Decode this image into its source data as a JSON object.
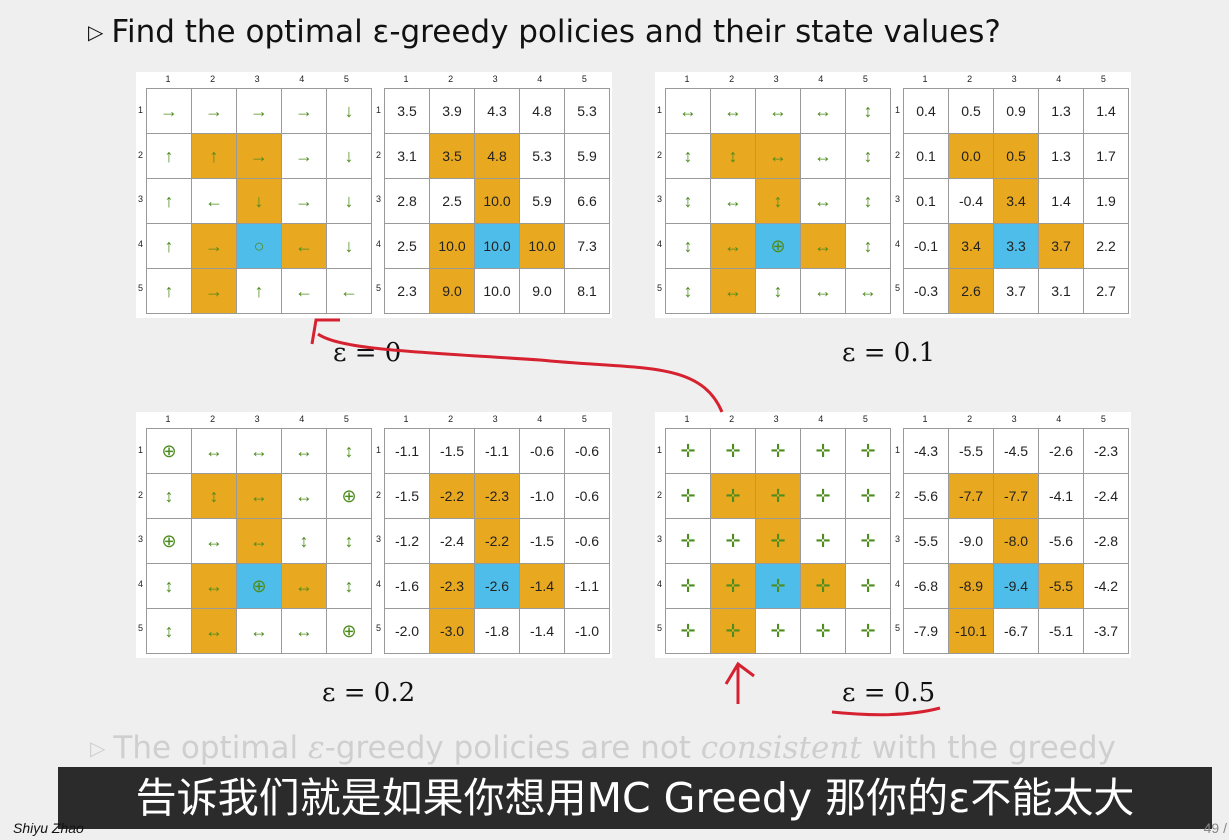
{
  "title": {
    "bullet_icon": "triangle-right-icon",
    "text": "Find the optimal ε-greedy policies and their state values?"
  },
  "col_labels": [
    "1",
    "2",
    "3",
    "4",
    "5"
  ],
  "row_labels": [
    "1",
    "2",
    "3",
    "4",
    "5"
  ],
  "colors": {
    "forbidden": "#e8a81f",
    "target": "#4fbde9",
    "arrows": "#4d8c1e",
    "annotation": "#d62230"
  },
  "panels": [
    {
      "eps_label": "ε = 0",
      "policy": [
        [
          "→",
          "→",
          "→",
          "→",
          "↓"
        ],
        [
          "↑",
          "↑",
          "→",
          "→",
          "↓"
        ],
        [
          "↑",
          "←",
          "↓",
          "→",
          "↓"
        ],
        [
          "↑",
          "→",
          "○",
          "←",
          "↓"
        ],
        [
          "↑",
          "→",
          "↑",
          "←",
          "←"
        ]
      ],
      "values": [
        [
          "3.5",
          "3.9",
          "4.3",
          "4.8",
          "5.3"
        ],
        [
          "3.1",
          "3.5",
          "4.8",
          "5.3",
          "5.9"
        ],
        [
          "2.8",
          "2.5",
          "10.0",
          "5.9",
          "6.6"
        ],
        [
          "2.5",
          "10.0",
          "10.0",
          "10.0",
          "7.3"
        ],
        [
          "2.3",
          "9.0",
          "10.0",
          "9.0",
          "8.1"
        ]
      ]
    },
    {
      "eps_label": "ε = 0.1",
      "policy": [
        [
          "↔",
          "↔",
          "↔",
          "↔",
          "↕"
        ],
        [
          "↕",
          "↕",
          "↔",
          "↔",
          "↕"
        ],
        [
          "↕",
          "↔",
          "↕",
          "↔",
          "↕"
        ],
        [
          "↕",
          "↔",
          "⊕",
          "↔",
          "↕"
        ],
        [
          "↕",
          "↔",
          "↕",
          "↔",
          "↔"
        ]
      ],
      "values": [
        [
          "0.4",
          "0.5",
          "0.9",
          "1.3",
          "1.4"
        ],
        [
          "0.1",
          "0.0",
          "0.5",
          "1.3",
          "1.7"
        ],
        [
          "0.1",
          "-0.4",
          "3.4",
          "1.4",
          "1.9"
        ],
        [
          "-0.1",
          "3.4",
          "3.3",
          "3.7",
          "2.2"
        ],
        [
          "-0.3",
          "2.6",
          "3.7",
          "3.1",
          "2.7"
        ]
      ]
    },
    {
      "eps_label": "ε = 0.2",
      "policy": [
        [
          "⊕",
          "↔",
          "↔",
          "↔",
          "↕"
        ],
        [
          "↕",
          "↕",
          "↔",
          "↔",
          "⊕"
        ],
        [
          "⊕",
          "↔",
          "↔",
          "↕",
          "↕"
        ],
        [
          "↕",
          "↔",
          "⊕",
          "↔",
          "↕"
        ],
        [
          "↕",
          "↔",
          "↔",
          "↔",
          "⊕"
        ]
      ],
      "values": [
        [
          "-1.1",
          "-1.5",
          "-1.1",
          "-0.6",
          "-0.6"
        ],
        [
          "-1.5",
          "-2.2",
          "-2.3",
          "-1.0",
          "-0.6"
        ],
        [
          "-1.2",
          "-2.4",
          "-2.2",
          "-1.5",
          "-0.6"
        ],
        [
          "-1.6",
          "-2.3",
          "-2.6",
          "-1.4",
          "-1.1"
        ],
        [
          "-2.0",
          "-3.0",
          "-1.8",
          "-1.4",
          "-1.0"
        ]
      ]
    },
    {
      "eps_label": "ε = 0.5",
      "policy": [
        [
          "✛",
          "✛",
          "✛",
          "✛",
          "✛"
        ],
        [
          "✛",
          "✛",
          "✛",
          "✛",
          "✛"
        ],
        [
          "✛",
          "✛",
          "✛",
          "✛",
          "✛"
        ],
        [
          "✛",
          "✛",
          "✛",
          "✛",
          "✛"
        ],
        [
          "✛",
          "✛",
          "✛",
          "✛",
          "✛"
        ]
      ],
      "values": [
        [
          "-4.3",
          "-5.5",
          "-4.5",
          "-2.6",
          "-2.3"
        ],
        [
          "-5.6",
          "-7.7",
          "-7.7",
          "-4.1",
          "-2.4"
        ],
        [
          "-5.5",
          "-9.0",
          "-8.0",
          "-5.6",
          "-2.8"
        ],
        [
          "-6.8",
          "-8.9",
          "-9.4",
          "-5.5",
          "-4.2"
        ],
        [
          "-7.9",
          "-10.1",
          "-6.7",
          "-5.1",
          "-3.7"
        ]
      ]
    }
  ],
  "bullet2": {
    "bullet_icon": "triangle-right-icon",
    "before": "The optimal ",
    "eps": "ε",
    "mid": "-greedy policies are not ",
    "em": "consistent",
    "after": " with the greedy"
  },
  "subtitle": "告诉我们就是如果你想用MC Greedy 那你的ε不能太大",
  "author": "Shiyu Zhao",
  "page_number": "49 / "
}
